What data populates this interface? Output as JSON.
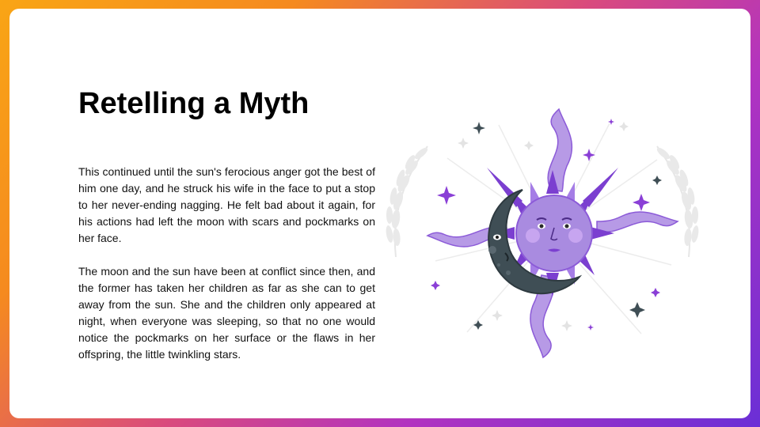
{
  "slide": {
    "title": "Retelling a Myth",
    "paragraphs": [
      "This continued until the sun's ferocious anger got the best of him one day, and he struck his wife in the face to put a stop to her never-ending nagging. He felt bad about it again, for his actions had left the moon with scars and pockmarks on her face.",
      "The moon and the sun have been at conflict since then, and the former has taken her children as far as she can to get away from the sun. She and the children only appeared at night, when everyone was sleeping, so that no one would notice the pockmarks on her surface or the flaws in her offspring, the little twinkling stars."
    ]
  },
  "illustration": {
    "icon": "sun-and-moon-illustration",
    "colors": {
      "sun_face": "#a98be0",
      "sun_rays": "#7b3fd0",
      "moon": "#3f4e55",
      "sparkle": "#8a3fd6",
      "laurel": "#e8e8e8"
    }
  },
  "theme": {
    "border_gradient": [
      "#f9a515",
      "#d94a7e",
      "#6a2fd6"
    ],
    "card_background": "#ffffff",
    "text_color": "#111111"
  }
}
